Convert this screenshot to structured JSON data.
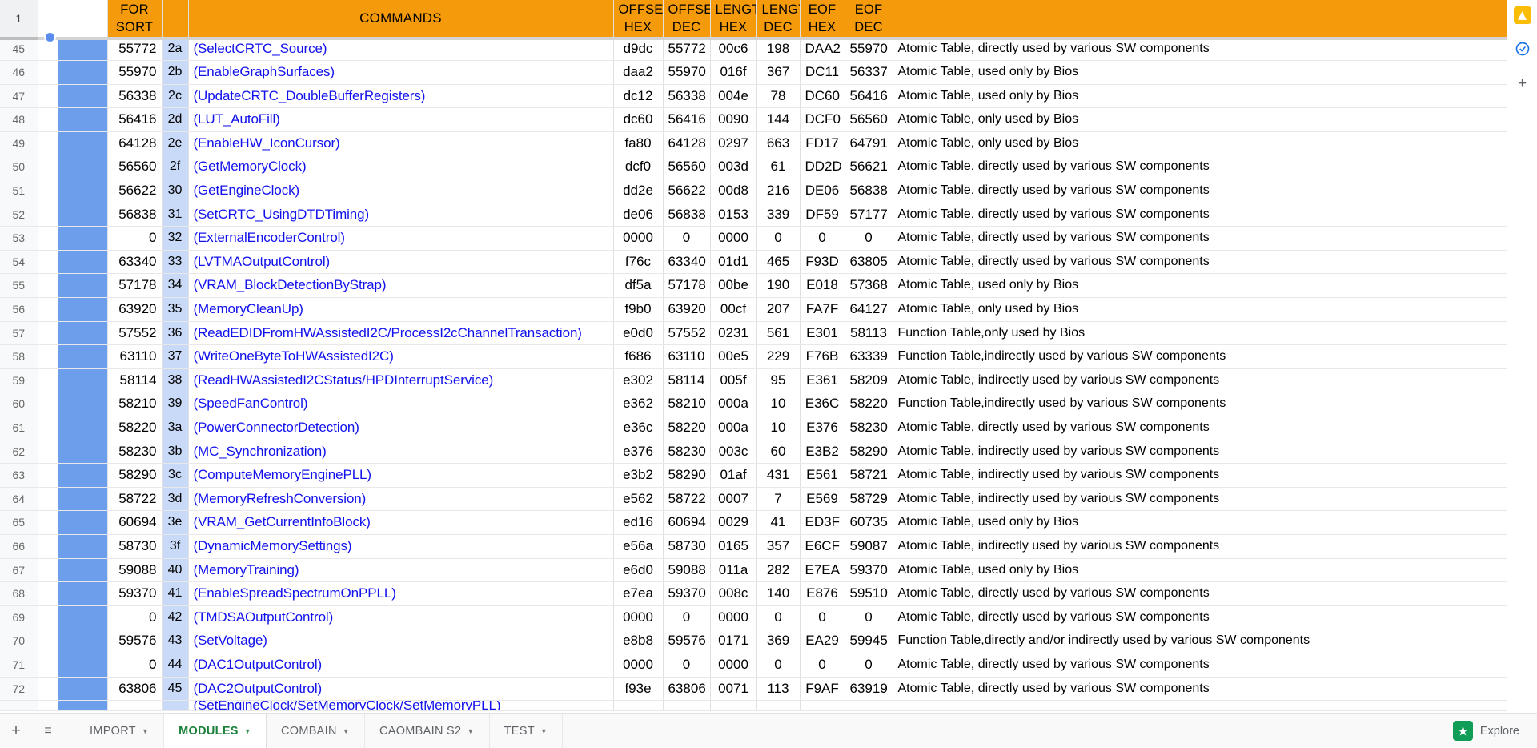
{
  "app": {
    "name": "Google Sheets"
  },
  "grid": {
    "header_row_number": "1",
    "columns": [
      {
        "key": "forsort",
        "label": "FOR\nSORT",
        "label_line1": "FOR",
        "label_line2": "SORT"
      },
      {
        "key": "idx",
        "label": ""
      },
      {
        "key": "commands",
        "label": "COMMANDS"
      },
      {
        "key": "offset_hex",
        "label_line1": "OFFSET",
        "label_line2": "HEX"
      },
      {
        "key": "offset_dec",
        "label_line1": "OFFSET",
        "label_line2": "DEC"
      },
      {
        "key": "length_hex",
        "label_line1": "LENGTH",
        "label_line2": "HEX"
      },
      {
        "key": "length_dec",
        "label_line1": "LENGTH",
        "label_line2": "DEC"
      },
      {
        "key": "eof_hex",
        "label_line1": "EOF",
        "label_line2": "HEX"
      },
      {
        "key": "eof_dec",
        "label_line1": "EOF",
        "label_line2": "DEC"
      },
      {
        "key": "description",
        "label": ""
      }
    ],
    "rows": [
      {
        "n": "45",
        "forsort": "55772",
        "idx": "2a",
        "cmd": "(SelectCRTC_Source)",
        "offhex": "d9dc",
        "offdec": "55772",
        "lenhex": "00c6",
        "lendec": "198",
        "eofhex": "DAA2",
        "eofdec": "55970",
        "desc": "Atomic Table,  directly used by various SW components"
      },
      {
        "n": "46",
        "forsort": "55970",
        "idx": "2b",
        "cmd": "(EnableGraphSurfaces)",
        "offhex": "daa2",
        "offdec": "55970",
        "lenhex": "016f",
        "lendec": "367",
        "eofhex": "DC11",
        "eofdec": "56337",
        "desc": "Atomic Table,  used only by Bios"
      },
      {
        "n": "47",
        "forsort": "56338",
        "idx": "2c",
        "cmd": "(UpdateCRTC_DoubleBufferRegisters)",
        "offhex": "dc12",
        "offdec": "56338",
        "lenhex": "004e",
        "lendec": "78",
        "eofhex": "DC60",
        "eofdec": "56416",
        "desc": "Atomic Table,  used only by Bios"
      },
      {
        "n": "48",
        "forsort": "56416",
        "idx": "2d",
        "cmd": "(LUT_AutoFill)",
        "offhex": "dc60",
        "offdec": "56416",
        "lenhex": "0090",
        "lendec": "144",
        "eofhex": "DCF0",
        "eofdec": "56560",
        "desc": "Atomic Table,  only used by Bios"
      },
      {
        "n": "49",
        "forsort": "64128",
        "idx": "2e",
        "cmd": "(EnableHW_IconCursor)",
        "offhex": "fa80",
        "offdec": "64128",
        "lenhex": "0297",
        "lendec": "663",
        "eofhex": "FD17",
        "eofdec": "64791",
        "desc": "Atomic Table,  only used by Bios"
      },
      {
        "n": "50",
        "forsort": "56560",
        "idx": "2f",
        "cmd": "(GetMemoryClock)",
        "offhex": "dcf0",
        "offdec": "56560",
        "lenhex": "003d",
        "lendec": "61",
        "eofhex": "DD2D",
        "eofdec": "56621",
        "desc": "Atomic Table,  directly used by various SW components"
      },
      {
        "n": "51",
        "forsort": "56622",
        "idx": "30",
        "cmd": "(GetEngineClock)",
        "offhex": "dd2e",
        "offdec": "56622",
        "lenhex": "00d8",
        "lendec": "216",
        "eofhex": "DE06",
        "eofdec": "56838",
        "desc": "Atomic Table,  directly used by various SW components"
      },
      {
        "n": "52",
        "forsort": "56838",
        "idx": "31",
        "cmd": "(SetCRTC_UsingDTDTiming)",
        "offhex": "de06",
        "offdec": "56838",
        "lenhex": "0153",
        "lendec": "339",
        "eofhex": "DF59",
        "eofdec": "57177",
        "desc": "Atomic Table,  directly used by various SW components"
      },
      {
        "n": "53",
        "forsort": "0",
        "idx": "32",
        "cmd": "(ExternalEncoderControl)",
        "offhex": "0000",
        "offdec": "0",
        "lenhex": "0000",
        "lendec": "0",
        "eofhex": "0",
        "eofdec": "0",
        "desc": "Atomic Table,  directly used by various SW components"
      },
      {
        "n": "54",
        "forsort": "63340",
        "idx": "33",
        "cmd": "(LVTMAOutputControl)",
        "offhex": "f76c",
        "offdec": "63340",
        "lenhex": "01d1",
        "lendec": "465",
        "eofhex": "F93D",
        "eofdec": "63805",
        "desc": "Atomic Table,  directly used by various SW components"
      },
      {
        "n": "55",
        "forsort": "57178",
        "idx": "34",
        "cmd": "(VRAM_BlockDetectionByStrap)",
        "offhex": "df5a",
        "offdec": "57178",
        "lenhex": "00be",
        "lendec": "190",
        "eofhex": "E018",
        "eofdec": "57368",
        "desc": "Atomic Table,  used only by Bios"
      },
      {
        "n": "56",
        "forsort": "63920",
        "idx": "35",
        "cmd": "(MemoryCleanUp)",
        "offhex": "f9b0",
        "offdec": "63920",
        "lenhex": "00cf",
        "lendec": "207",
        "eofhex": "FA7F",
        "eofdec": "64127",
        "desc": "Atomic Table,  only used by Bios"
      },
      {
        "n": "57",
        "forsort": "57552",
        "idx": "36",
        "cmd": "(ReadEDIDFromHWAssistedI2C/ProcessI2cChannelTransaction)",
        "offhex": "e0d0",
        "offdec": "57552",
        "lenhex": "0231",
        "lendec": "561",
        "eofhex": "E301",
        "eofdec": "58113",
        "desc": "Function Table,only used by Bios"
      },
      {
        "n": "58",
        "forsort": "63110",
        "idx": "37",
        "cmd": "(WriteOneByteToHWAssistedI2C)",
        "offhex": "f686",
        "offdec": "63110",
        "lenhex": "00e5",
        "lendec": "229",
        "eofhex": "F76B",
        "eofdec": "63339",
        "desc": "Function Table,indirectly used by various SW components"
      },
      {
        "n": "59",
        "forsort": "58114",
        "idx": "38",
        "cmd": "(ReadHWAssistedI2CStatus/HPDInterruptService)",
        "offhex": "e302",
        "offdec": "58114",
        "lenhex": "005f",
        "lendec": "95",
        "eofhex": "E361",
        "eofdec": "58209",
        "desc": "Atomic Table,  indirectly used by various SW components"
      },
      {
        "n": "60",
        "forsort": "58210",
        "idx": "39",
        "cmd": "(SpeedFanControl)",
        "offhex": "e362",
        "offdec": "58210",
        "lenhex": "000a",
        "lendec": "10",
        "eofhex": "E36C",
        "eofdec": "58220",
        "desc": "Function Table,indirectly used by various SW components"
      },
      {
        "n": "61",
        "forsort": "58220",
        "idx": "3a",
        "cmd": "(PowerConnectorDetection)",
        "offhex": "e36c",
        "offdec": "58220",
        "lenhex": "000a",
        "lendec": "10",
        "eofhex": "E376",
        "eofdec": "58230",
        "desc": "Atomic Table,  directly used by various SW components"
      },
      {
        "n": "62",
        "forsort": "58230",
        "idx": "3b",
        "cmd": "(MC_Synchronization)",
        "offhex": "e376",
        "offdec": "58230",
        "lenhex": "003c",
        "lendec": "60",
        "eofhex": "E3B2",
        "eofdec": "58290",
        "desc": "Atomic Table,  indirectly used by various SW components"
      },
      {
        "n": "63",
        "forsort": "58290",
        "idx": "3c",
        "cmd": "(ComputeMemoryEnginePLL)",
        "offhex": "e3b2",
        "offdec": "58290",
        "lenhex": "01af",
        "lendec": "431",
        "eofhex": "E561",
        "eofdec": "58721",
        "desc": "Atomic Table,  indirectly used by various SW components"
      },
      {
        "n": "64",
        "forsort": "58722",
        "idx": "3d",
        "cmd": "(MemoryRefreshConversion)",
        "offhex": "e562",
        "offdec": "58722",
        "lenhex": "0007",
        "lendec": "7",
        "eofhex": "E569",
        "eofdec": "58729",
        "desc": "Atomic Table,  indirectly used by various SW components"
      },
      {
        "n": "65",
        "forsort": "60694",
        "idx": "3e",
        "cmd": "(VRAM_GetCurrentInfoBlock)",
        "offhex": "ed16",
        "offdec": "60694",
        "lenhex": "0029",
        "lendec": "41",
        "eofhex": "ED3F",
        "eofdec": "60735",
        "desc": "Atomic Table,  used only by Bios"
      },
      {
        "n": "66",
        "forsort": "58730",
        "idx": "3f",
        "cmd": "(DynamicMemorySettings)",
        "offhex": "e56a",
        "offdec": "58730",
        "lenhex": "0165",
        "lendec": "357",
        "eofhex": "E6CF",
        "eofdec": "59087",
        "desc": "Atomic Table,  indirectly used by various SW components"
      },
      {
        "n": "67",
        "forsort": "59088",
        "idx": "40",
        "cmd": "(MemoryTraining)",
        "offhex": "e6d0",
        "offdec": "59088",
        "lenhex": "011a",
        "lendec": "282",
        "eofhex": "E7EA",
        "eofdec": "59370",
        "desc": "Atomic Table,  used only by Bios"
      },
      {
        "n": "68",
        "forsort": "59370",
        "idx": "41",
        "cmd": "(EnableSpreadSpectrumOnPPLL)",
        "offhex": "e7ea",
        "offdec": "59370",
        "lenhex": "008c",
        "lendec": "140",
        "eofhex": "E876",
        "eofdec": "59510",
        "desc": "Atomic Table,  directly used by various SW components"
      },
      {
        "n": "69",
        "forsort": "0",
        "idx": "42",
        "cmd": "(TMDSAOutputControl)",
        "offhex": "0000",
        "offdec": "0",
        "lenhex": "0000",
        "lendec": "0",
        "eofhex": "0",
        "eofdec": "0",
        "desc": "Atomic Table,  directly used by various SW components"
      },
      {
        "n": "70",
        "forsort": "59576",
        "idx": "43",
        "cmd": "(SetVoltage)",
        "offhex": "e8b8",
        "offdec": "59576",
        "lenhex": "0171",
        "lendec": "369",
        "eofhex": "EA29",
        "eofdec": "59945",
        "desc": "Function Table,directly and/or indirectly used by various SW components"
      },
      {
        "n": "71",
        "forsort": "0",
        "idx": "44",
        "cmd": "(DAC1OutputControl)",
        "offhex": "0000",
        "offdec": "0",
        "lenhex": "0000",
        "lendec": "0",
        "eofhex": "0",
        "eofdec": "0",
        "desc": "Atomic Table,  directly used by various SW components"
      },
      {
        "n": "72",
        "forsort": "63806",
        "idx": "45",
        "cmd": "(DAC2OutputControl)",
        "offhex": "f93e",
        "offdec": "63806",
        "lenhex": "0071",
        "lendec": "113",
        "eofhex": "F9AF",
        "eofdec": "63919",
        "desc": "Atomic Table,  directly used by various SW components"
      }
    ],
    "clipped_row": {
      "cmd": "(SetEngineClock/SetMemoryClock/SetMemoryPLL)"
    }
  },
  "right_rail": {
    "items": [
      {
        "name": "keep-icon",
        "glyph": "◆"
      },
      {
        "name": "tasks-icon",
        "glyph": "✔"
      },
      {
        "name": "add-icon",
        "glyph": "+"
      }
    ]
  },
  "tabbar": {
    "add_sheet_label": "+",
    "all_sheets_label": "≡",
    "tabs": [
      {
        "label": "IMPORT",
        "active": false
      },
      {
        "label": "MODULES",
        "active": true
      },
      {
        "label": "COMBAIN",
        "active": false
      },
      {
        "label": "CAOMBAIN S2",
        "active": false
      },
      {
        "label": "TEST",
        "active": false
      }
    ],
    "explore_label": "Explore",
    "explore_glyph": "✦"
  },
  "colors": {
    "header_orange": "#f59b0b",
    "link_blue": "#1111ee",
    "index_blue": "#c9daf8",
    "selection_blue": "#6d9eeb",
    "active_tab_green": "#188038",
    "explore_green": "#0f9d58"
  }
}
